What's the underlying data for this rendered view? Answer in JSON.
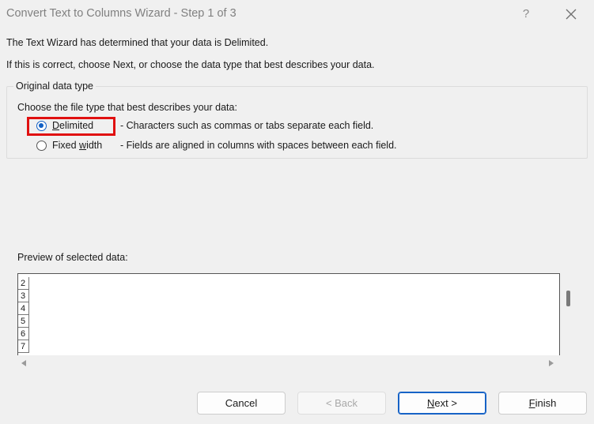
{
  "window": {
    "title": "Convert Text to Columns Wizard - Step 1 of 3",
    "help_label": "?"
  },
  "intro": {
    "line1": "The Text Wizard has determined that your data is Delimited.",
    "line2": "If this is correct, choose Next, or choose the data type that best describes your data."
  },
  "original_data_type": {
    "group_label": "Original data type",
    "prompt": "Choose the file type that best describes your data:",
    "options": [
      {
        "label": "Delimited",
        "description": "- Characters such as commas or tabs separate each field.",
        "selected": true
      },
      {
        "label": "Fixed width",
        "description": "- Fields are aligned in columns with spaces between each field.",
        "selected": false
      }
    ]
  },
  "preview": {
    "label": "Preview of selected data:",
    "row_numbers": [
      "2",
      "3",
      "4",
      "5",
      "6",
      "7"
    ]
  },
  "buttons": {
    "cancel": "Cancel",
    "back": "< Back",
    "next": "Next >",
    "finish": "Finish"
  },
  "colors": {
    "accent": "#0f5fc4",
    "highlight": "#e01010",
    "next_border": "#1763c6"
  }
}
